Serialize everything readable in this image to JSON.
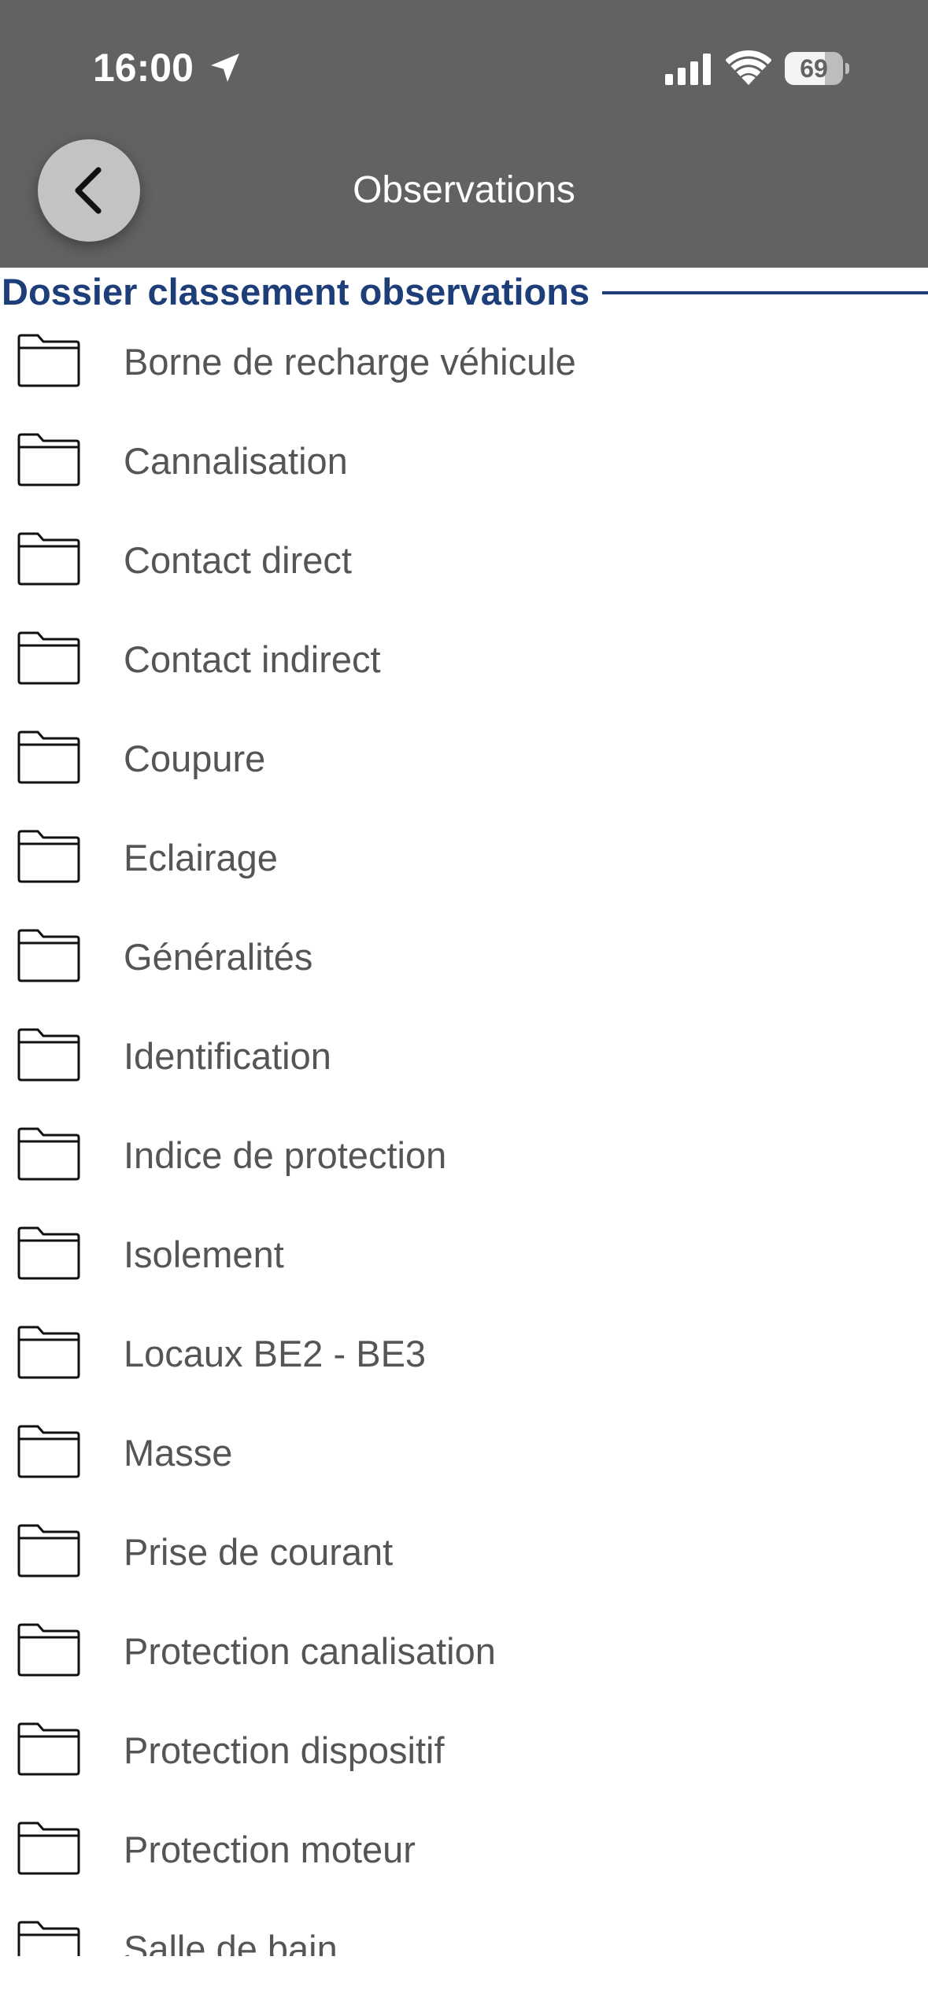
{
  "status_bar": {
    "time": "16:00",
    "battery_percent": "69",
    "battery_level": 0.69,
    "icons": [
      "location-arrow-icon",
      "cellular-signal-icon",
      "wifi-icon",
      "battery-icon"
    ]
  },
  "header": {
    "title": "Observations",
    "back_icon": "chevron-left-icon"
  },
  "section": {
    "title": "Dossier classement observations"
  },
  "folders": [
    {
      "label": "Borne de recharge véhicule"
    },
    {
      "label": "Cannalisation"
    },
    {
      "label": "Contact direct"
    },
    {
      "label": "Contact indirect"
    },
    {
      "label": "Coupure"
    },
    {
      "label": "Eclairage"
    },
    {
      "label": "Généralités"
    },
    {
      "label": "Identification"
    },
    {
      "label": "Indice de protection"
    },
    {
      "label": "Isolement"
    },
    {
      "label": "Locaux BE2 - BE3"
    },
    {
      "label": "Masse"
    },
    {
      "label": "Prise de courant"
    },
    {
      "label": "Protection canalisation"
    },
    {
      "label": "Protection dispositif"
    },
    {
      "label": "Protection moteur"
    },
    {
      "label": "Salle de bain"
    }
  ],
  "colors": {
    "header_bg": "#626262",
    "section_title": "#1d3e78",
    "item_text": "#555555",
    "back_button_bg": "#c3c3c3"
  }
}
